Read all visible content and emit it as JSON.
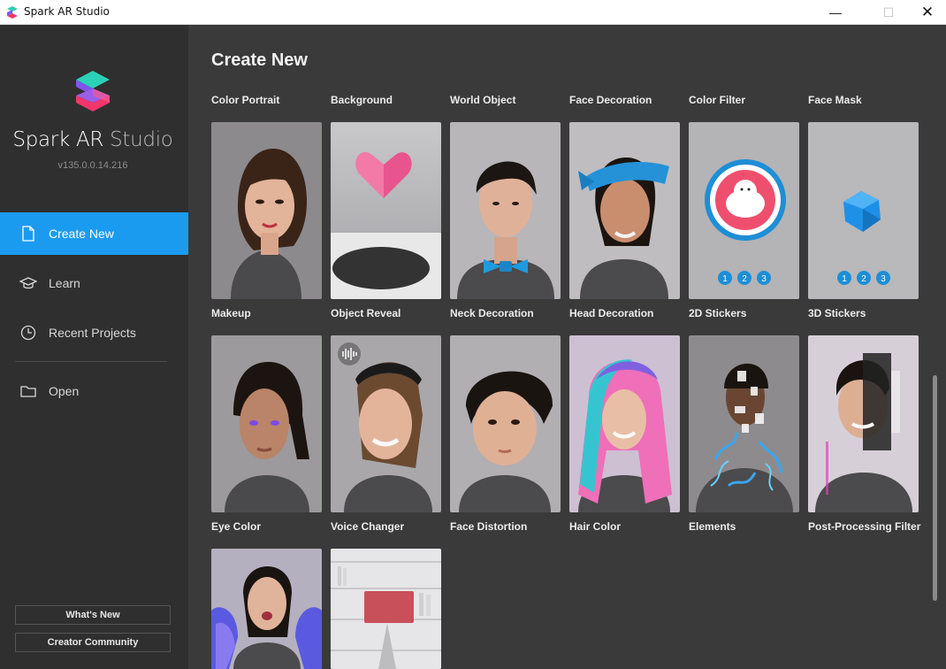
{
  "window": {
    "title": "Spark AR Studio",
    "minimize_glyph": "—",
    "maximize_glyph": "☐",
    "close_glyph": "✕"
  },
  "sidebar": {
    "brand_main": "Spark AR",
    "brand_sub": "Studio",
    "version": "v135.0.0.14.216",
    "nav": [
      {
        "label": "Create New",
        "icon": "file-icon",
        "active": true
      },
      {
        "label": "Learn",
        "icon": "graduation-cap-icon",
        "active": false
      },
      {
        "label": "Recent Projects",
        "icon": "clock-icon",
        "active": false
      },
      {
        "label": "Open",
        "icon": "folder-icon",
        "active": false
      }
    ],
    "whats_new": "What's New",
    "creator_community": "Creator Community"
  },
  "main": {
    "heading": "Create New",
    "row0_labels": [
      "Color Portrait",
      "Background",
      "World Object",
      "Face Decoration",
      "Color Filter",
      "Face Mask"
    ],
    "templates": [
      {
        "label": "Makeup"
      },
      {
        "label": "Object Reveal"
      },
      {
        "label": "Neck Decoration"
      },
      {
        "label": "Head Decoration"
      },
      {
        "label": "2D Stickers",
        "badges": [
          "1",
          "2",
          "3"
        ]
      },
      {
        "label": "3D Stickers",
        "badges": [
          "1",
          "2",
          "3"
        ]
      },
      {
        "label": "Eye Color"
      },
      {
        "label": "Voice Changer"
      },
      {
        "label": "Face Distortion"
      },
      {
        "label": "Hair Color"
      },
      {
        "label": "Elements"
      },
      {
        "label": "Post-Processing Filter"
      }
    ]
  },
  "colors": {
    "accent": "#1a9bf0",
    "sidebar_bg": "#2f2f2f",
    "main_bg": "#3a3a3a"
  }
}
